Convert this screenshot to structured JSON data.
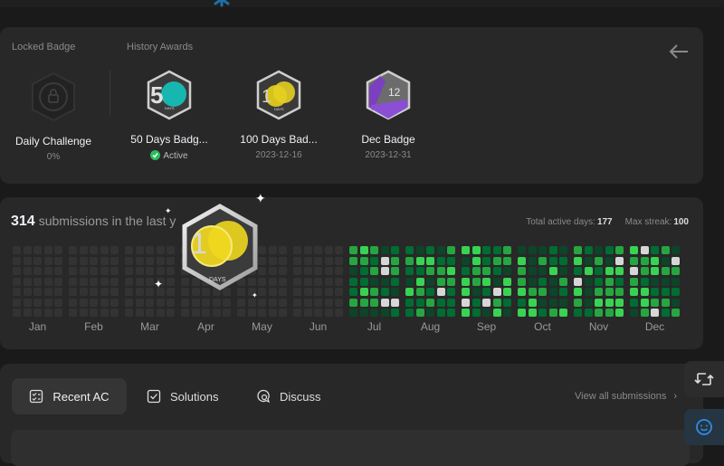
{
  "locked_section": {
    "label": "Locked Badge",
    "badge": {
      "name": "Daily Challenge",
      "sub": "0%"
    }
  },
  "history_section": {
    "label": "History Awards",
    "badges": [
      {
        "name": "50 Days Badg...",
        "sub": "Active",
        "icon": "50-days-badge-icon"
      },
      {
        "name": "100 Days Bad...",
        "sub": "2023-12-16",
        "icon": "100-days-badge-icon"
      },
      {
        "name": "Dec Badge",
        "sub": "2023-12-31",
        "icon": "dec-badge-icon"
      }
    ]
  },
  "activity": {
    "count": "314",
    "title_text": "submissions in the last y",
    "total_active_label": "Total active days:",
    "total_active_value": "177",
    "max_streak_label": "Max streak:",
    "max_streak_value": "100",
    "months": [
      "Jan",
      "Feb",
      "Mar",
      "Apr",
      "May",
      "Jun",
      "Jul",
      "Aug",
      "Sep",
      "Oct",
      "Nov",
      "Dec"
    ]
  },
  "floating_badge": {
    "text": "DAYS"
  },
  "badge_labels": {
    "days_small": "DAYS",
    "dec_number": "12"
  },
  "tabs": [
    {
      "label": "Recent AC",
      "active": true,
      "icon": "checklist-icon"
    },
    {
      "label": "Solutions",
      "active": false,
      "icon": "checkbox-icon"
    },
    {
      "label": "Discuss",
      "active": false,
      "icon": "discuss-icon"
    }
  ],
  "view_all_label": "View all submissions",
  "colors": {
    "background": "#1a1a1a",
    "card": "#282828",
    "accent_green": "#2cbb5d",
    "heat_empty": "#333333",
    "heat_levels": [
      "#0e4429",
      "#006d32",
      "#26a641",
      "#39d353"
    ]
  }
}
